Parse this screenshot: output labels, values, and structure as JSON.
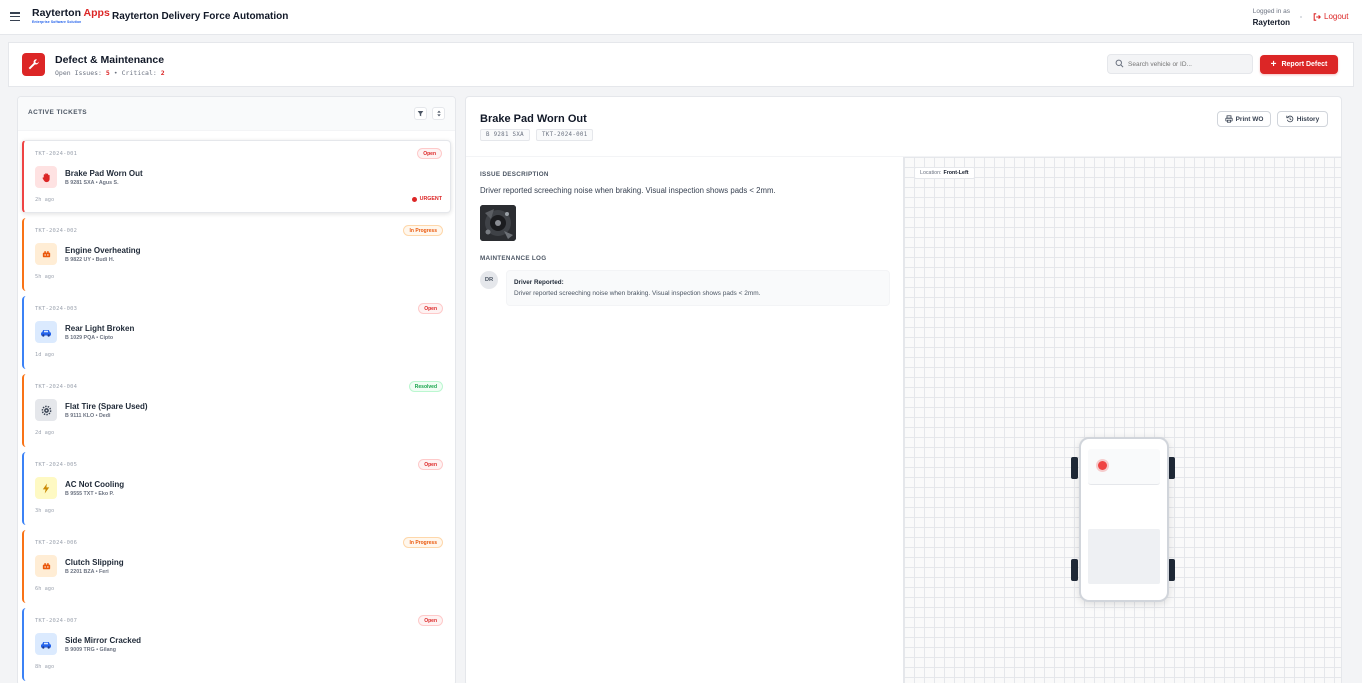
{
  "topbar": {
    "brand_main": "Rayterton",
    "brand_accent": "Apps",
    "brand_tagline": "Enterprise Software Solution",
    "app_title": "Rayterton Delivery Force Automation",
    "logged_in_label": "Logged in as",
    "user": "Rayterton",
    "logout_label": "Logout"
  },
  "header": {
    "title": "Defect & Maintenance",
    "open_label": "Open Issues:",
    "open_count": "5",
    "separator": "•",
    "critical_label": "Critical:",
    "critical_count": "2",
    "search_placeholder": "Search vehicle or ID...",
    "report_button": "Report Defect"
  },
  "left": {
    "title": "ACTIVE TICKETS"
  },
  "tickets": [
    {
      "id": "TKT-2024-001",
      "status": "Open",
      "title": "Brake Pad Worn Out",
      "meta": "B 9281 SXA • Agus S.",
      "age": "2h ago",
      "urgent": "URGENT",
      "icon": "hand-stop-icon"
    },
    {
      "id": "TKT-2024-002",
      "status": "In Progress",
      "title": "Engine Overheating",
      "meta": "B 9822 UY • Budi H.",
      "age": "5h ago",
      "icon": "engine-icon"
    },
    {
      "id": "TKT-2024-003",
      "status": "Open",
      "title": "Rear Light Broken",
      "meta": "B 1029 PQA • Cipto",
      "age": "1d ago",
      "icon": "car-icon"
    },
    {
      "id": "TKT-2024-004",
      "status": "Resolved",
      "title": "Flat Tire (Spare Used)",
      "meta": "B 9111 KLO • Dedi",
      "age": "2d ago",
      "icon": "gear-icon"
    },
    {
      "id": "TKT-2024-005",
      "status": "Open",
      "title": "AC Not Cooling",
      "meta": "B 9555 TXT • Eko P.",
      "age": "3h ago",
      "icon": "bolt-icon"
    },
    {
      "id": "TKT-2024-006",
      "status": "In Progress",
      "title": "Clutch Slipping",
      "meta": "B 2201 BZA • Feri",
      "age": "6h ago",
      "icon": "engine-icon"
    },
    {
      "id": "TKT-2024-007",
      "status": "Open",
      "title": "Side Mirror Cracked",
      "meta": "B 9009 TRG • Gilang",
      "age": "8h ago",
      "icon": "car-icon"
    }
  ],
  "detail": {
    "title": "Brake Pad Worn Out",
    "plate": "B 9281 SXA",
    "ticket_id": "TKT-2024-001",
    "print_button": "Print WO",
    "history_button": "History",
    "issue_label": "ISSUE DESCRIPTION",
    "issue_text": "Driver reported screeching noise when braking. Visual inspection shows pads < 2mm.",
    "log_label": "MAINTENANCE LOG",
    "log_avatar": "DR",
    "log_head": "Driver Reported:",
    "log_text": "Driver reported screeching noise when braking. Visual inspection shows pads < 2mm.",
    "location_label": "Location:",
    "location_value": "Front-Left"
  },
  "colors": {
    "accent": "#dc2626",
    "open": "#ef4444",
    "in_progress": "#f97316",
    "resolved": "#22c55e",
    "info": "#3b82f6"
  }
}
